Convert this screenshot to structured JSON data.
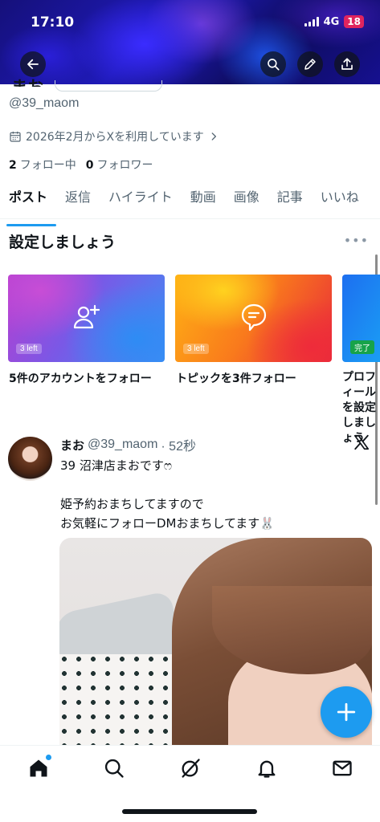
{
  "status_bar": {
    "time": "17:10",
    "network": "4G",
    "battery": "18"
  },
  "profile": {
    "name": "まお",
    "handle": "@39_maom",
    "joined": "2026年2月からXを利用しています",
    "following_count": "2",
    "following_label": "フォロー中",
    "followers_count": "0",
    "followers_label": "フォロワー"
  },
  "tabs": [
    "ポスト",
    "返信",
    "ハイライト",
    "動画",
    "画像",
    "記事",
    "いいね"
  ],
  "setup": {
    "title": "設定しましょう",
    "cards": [
      {
        "badge": "3 left",
        "label": "5件のアカウントをフォロー"
      },
      {
        "badge": "3 left",
        "label": "トピックを3件フォロー"
      },
      {
        "badge": "完了",
        "label": "プロフィールを設定しましょう"
      }
    ]
  },
  "post": {
    "name": "まお",
    "handle": "@39_maom",
    "time": "· 52秒",
    "text": "39 沼津店まおですෆ\n\n姫予約おまちしてますので\nお気軽にフォローDMおまちしてます🐰"
  },
  "colors": {
    "accent": "#1d9bf0",
    "text": "#0f1419",
    "secondary": "#536471"
  },
  "icons": {
    "header": [
      "back-arrow-icon",
      "search-icon",
      "edit-pencil-icon",
      "share-icon"
    ],
    "bottom_nav": [
      "home-icon",
      "search-icon",
      "grok-icon",
      "bell-icon",
      "mail-icon"
    ]
  }
}
